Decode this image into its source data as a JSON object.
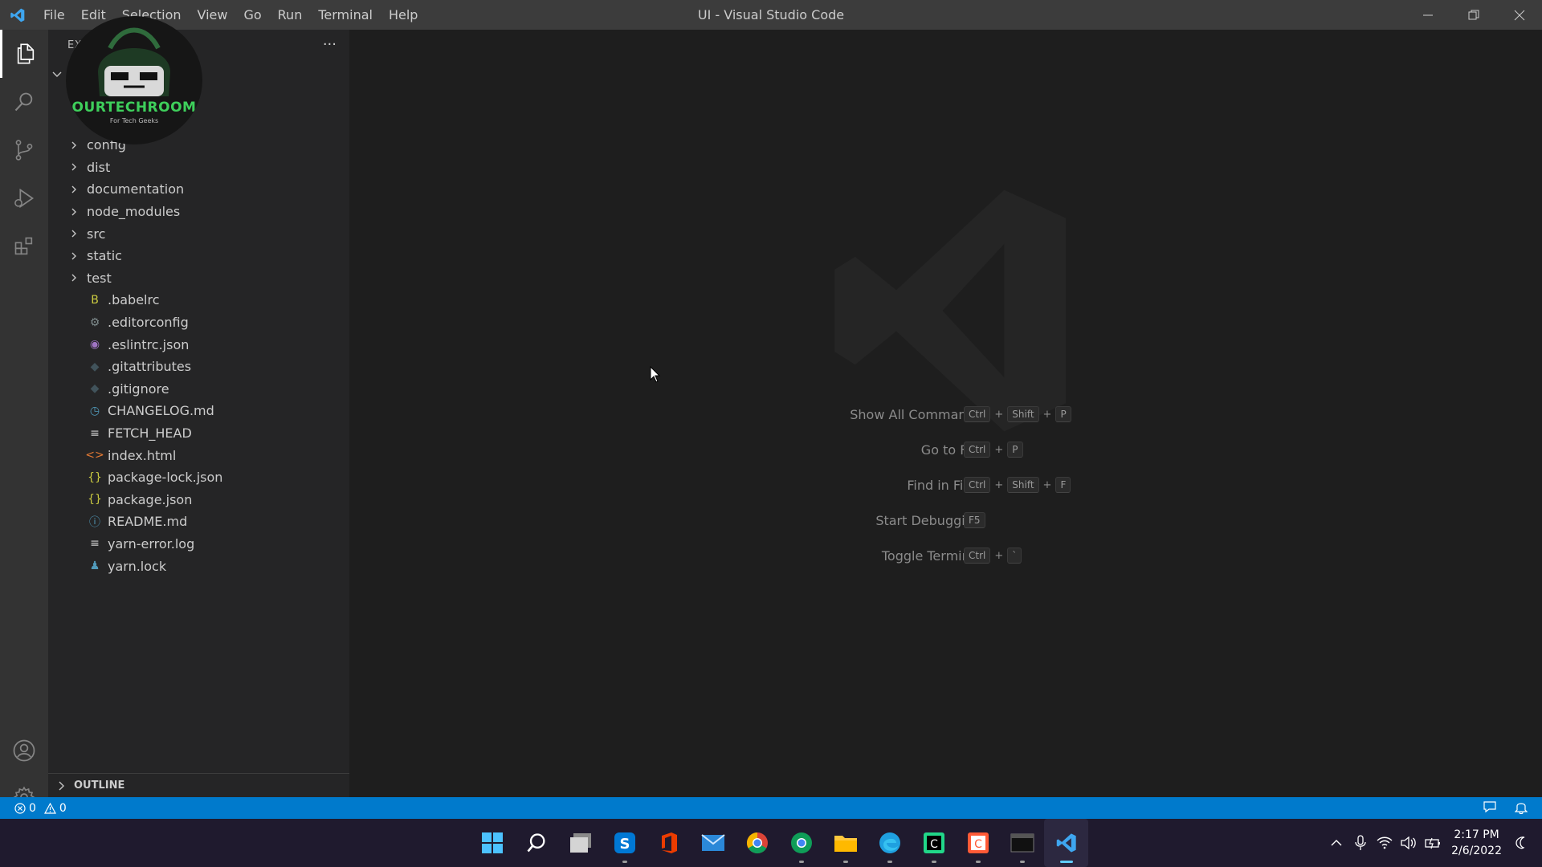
{
  "window": {
    "title": "UI - Visual Studio Code"
  },
  "menu": [
    "File",
    "Edit",
    "Selection",
    "View",
    "Go",
    "Run",
    "Terminal",
    "Help"
  ],
  "sidebar": {
    "header": "EXPLORER",
    "more": "···",
    "folders": [
      "config",
      "dist",
      "documentation",
      "node_modules",
      "src",
      "static",
      "test"
    ],
    "files": [
      {
        "name": ".babelrc",
        "icon": "babel-icon",
        "glyph": "B",
        "color": "#cbcb41"
      },
      {
        "name": ".editorconfig",
        "icon": "gear-icon",
        "glyph": "⚙",
        "color": "#7f8c8d"
      },
      {
        "name": ".eslintrc.json",
        "icon": "eslint-icon",
        "glyph": "◉",
        "color": "#a074c4"
      },
      {
        "name": ".gitattributes",
        "icon": "git-icon",
        "glyph": "◆",
        "color": "#41535b"
      },
      {
        "name": ".gitignore",
        "icon": "git-icon",
        "glyph": "◆",
        "color": "#41535b"
      },
      {
        "name": "CHANGELOG.md",
        "icon": "clock-icon",
        "glyph": "◷",
        "color": "#519aba"
      },
      {
        "name": "FETCH_HEAD",
        "icon": "lines-icon",
        "glyph": "≡",
        "color": "#cccccc"
      },
      {
        "name": "index.html",
        "icon": "html-icon",
        "glyph": "<>",
        "color": "#e37933"
      },
      {
        "name": "package-lock.json",
        "icon": "json-icon",
        "glyph": "{}",
        "color": "#cbcb41"
      },
      {
        "name": "package.json",
        "icon": "json-icon",
        "glyph": "{}",
        "color": "#cbcb41"
      },
      {
        "name": "README.md",
        "icon": "info-icon",
        "glyph": "ⓘ",
        "color": "#519aba"
      },
      {
        "name": "yarn-error.log",
        "icon": "lines-icon",
        "glyph": "≡",
        "color": "#cccccc"
      },
      {
        "name": "yarn.lock",
        "icon": "yarn-icon",
        "glyph": "♟",
        "color": "#519aba"
      }
    ],
    "outline": "OUTLINE"
  },
  "brand": {
    "name": "OURTECHROOM",
    "tagline": "For Tech Geeks"
  },
  "shortcuts": [
    {
      "label": "Show All Commands",
      "keys": [
        "Ctrl",
        "Shift",
        "P"
      ]
    },
    {
      "label": "Go to File",
      "keys": [
        "Ctrl",
        "P"
      ]
    },
    {
      "label": "Find in Files",
      "keys": [
        "Ctrl",
        "Shift",
        "F"
      ]
    },
    {
      "label": "Start Debugging",
      "keys": [
        "F5"
      ]
    },
    {
      "label": "Toggle Terminal",
      "keys": [
        "Ctrl",
        "`"
      ]
    }
  ],
  "status": {
    "errors": "0",
    "warnings": "0"
  },
  "clock": {
    "time": "2:17 PM",
    "date": "2/6/2022"
  },
  "colors": {
    "accent": "#007acc",
    "sidebar": "#252526",
    "editor": "#1e1e1e",
    "activitybar": "#333333"
  }
}
